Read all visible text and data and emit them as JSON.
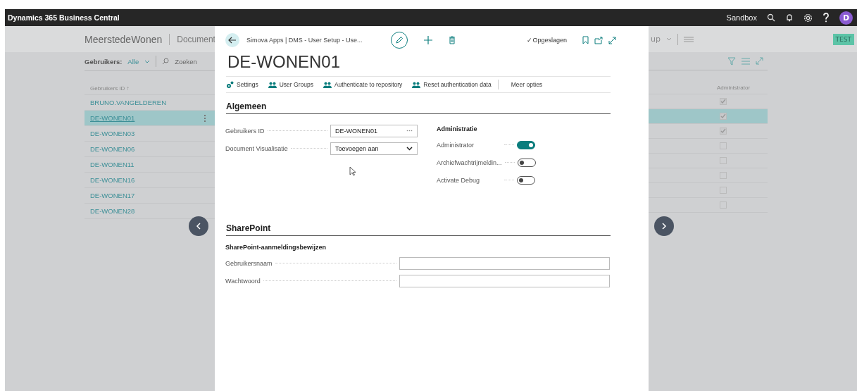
{
  "app_bar": {
    "title": "Dynamics 365 Business Central",
    "environment": "Sandbox",
    "avatar": "D"
  },
  "background_page": {
    "company": "MeerstedeWonen",
    "tab": "Document",
    "filter_label": "Gebruikers:",
    "filter_value": "Alle",
    "search": "Zoeken",
    "right_menu": "up",
    "badge": "TEST",
    "columns": [
      {
        "label": "Gebruikers ID ↑"
      },
      {
        "label": "Administrator"
      }
    ],
    "rows": [
      {
        "id": "BRUNO.VANGELDEREN",
        "selected": false,
        "administrator": true
      },
      {
        "id": "DE-WONEN01",
        "selected": true,
        "administrator": true
      },
      {
        "id": "DE-WONEN03",
        "selected": false,
        "administrator": true
      },
      {
        "id": "DE-WONEN06",
        "selected": false,
        "administrator": false
      },
      {
        "id": "DE-WONEN11",
        "selected": false,
        "administrator": false
      },
      {
        "id": "DE-WONEN16",
        "selected": false,
        "administrator": false
      },
      {
        "id": "DE-WONEN17",
        "selected": false,
        "administrator": false
      },
      {
        "id": "DE-WONEN28",
        "selected": false,
        "administrator": false
      }
    ]
  },
  "dialog": {
    "breadcrumb": "Simova Apps | DMS - User Setup - Use...",
    "status": "✓Opgeslagen",
    "title": "DE-WONEN01",
    "actions": [
      {
        "label": "Settings",
        "kind": "gear"
      },
      {
        "label": "User Groups",
        "kind": "people"
      },
      {
        "label": "Authenticate to repository",
        "kind": "people"
      },
      {
        "label": "Reset authentication data",
        "kind": "people"
      },
      {
        "label": "Meer opties",
        "kind": "more"
      }
    ],
    "general": {
      "heading": "Algemeen",
      "fields": [
        {
          "label": "Gebruikers ID",
          "value": "DE-WONEN01",
          "kind": "lookup"
        },
        {
          "label": "Document Visualisatie",
          "value": "Toevoegen aan",
          "kind": "select"
        }
      ],
      "admin_heading": "Administratie",
      "toggles": [
        {
          "label": "Administrator",
          "on": true
        },
        {
          "label": "Archiefwachtrijmeldin...",
          "on": false
        },
        {
          "label": "Activate Debug",
          "on": false
        }
      ]
    },
    "sharepoint": {
      "heading": "SharePoint",
      "subheading": "SharePoint-aanmeldingsbewijzen",
      "fields": [
        {
          "label": "Gebruikersnaam"
        },
        {
          "label": "Wachtwoord"
        }
      ]
    }
  }
}
